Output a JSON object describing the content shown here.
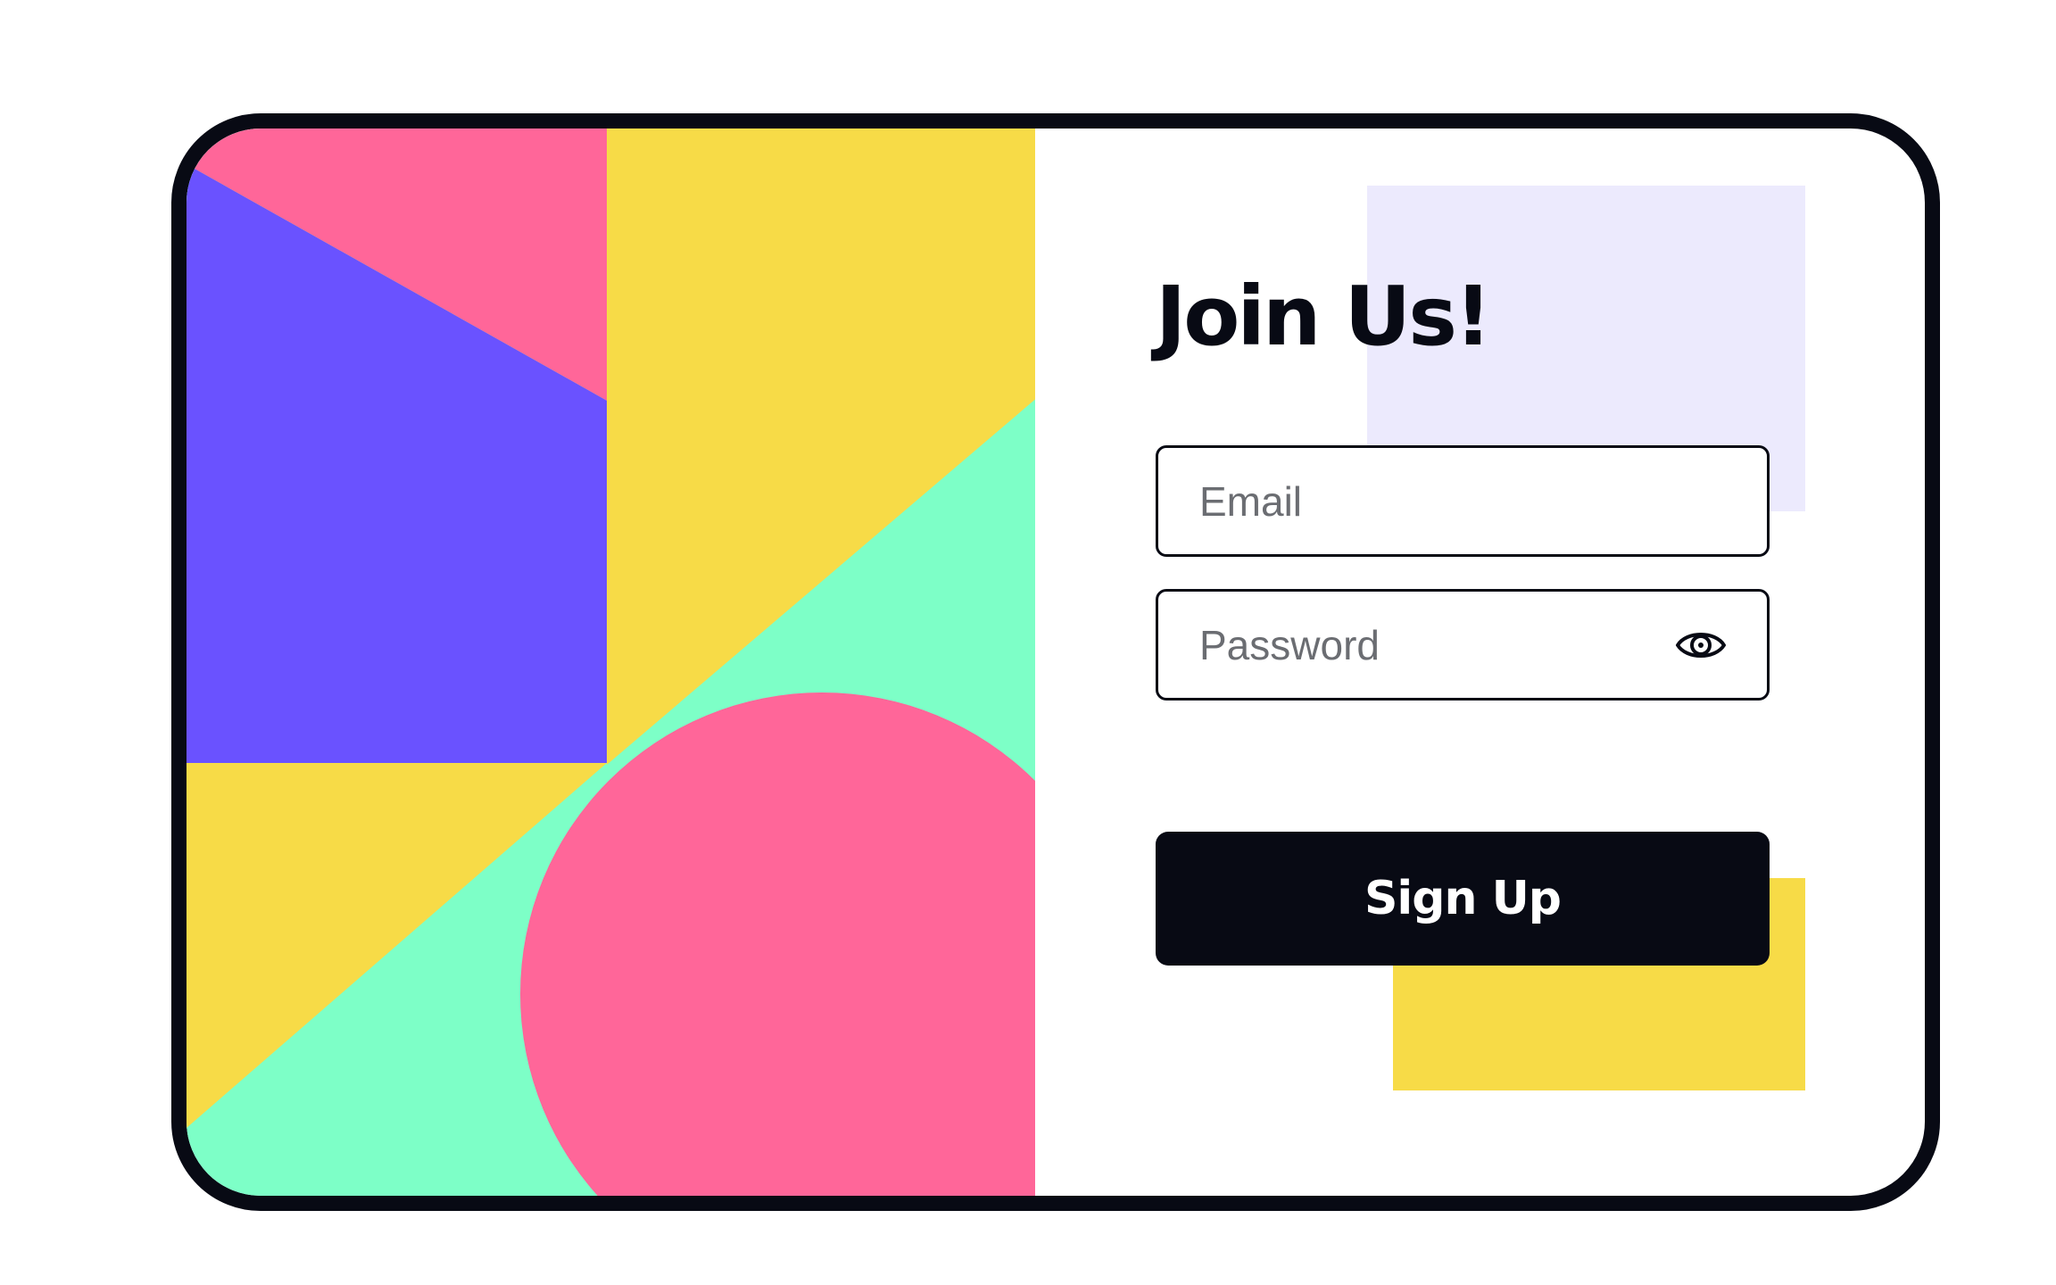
{
  "form": {
    "title": "Join Us!",
    "email_placeholder": "Email",
    "email_value": "",
    "password_placeholder": "Password",
    "password_value": "",
    "submit_label": "Sign Up"
  },
  "icons": {
    "password_toggle": "eye-icon"
  },
  "colors": {
    "pink": "#ff6699",
    "purple": "#6a52ff",
    "yellow": "#f7db47",
    "mint": "#7dffc7",
    "lavender": "#eceafd",
    "ink": "#080a14",
    "placeholder": "#6b6d72"
  }
}
